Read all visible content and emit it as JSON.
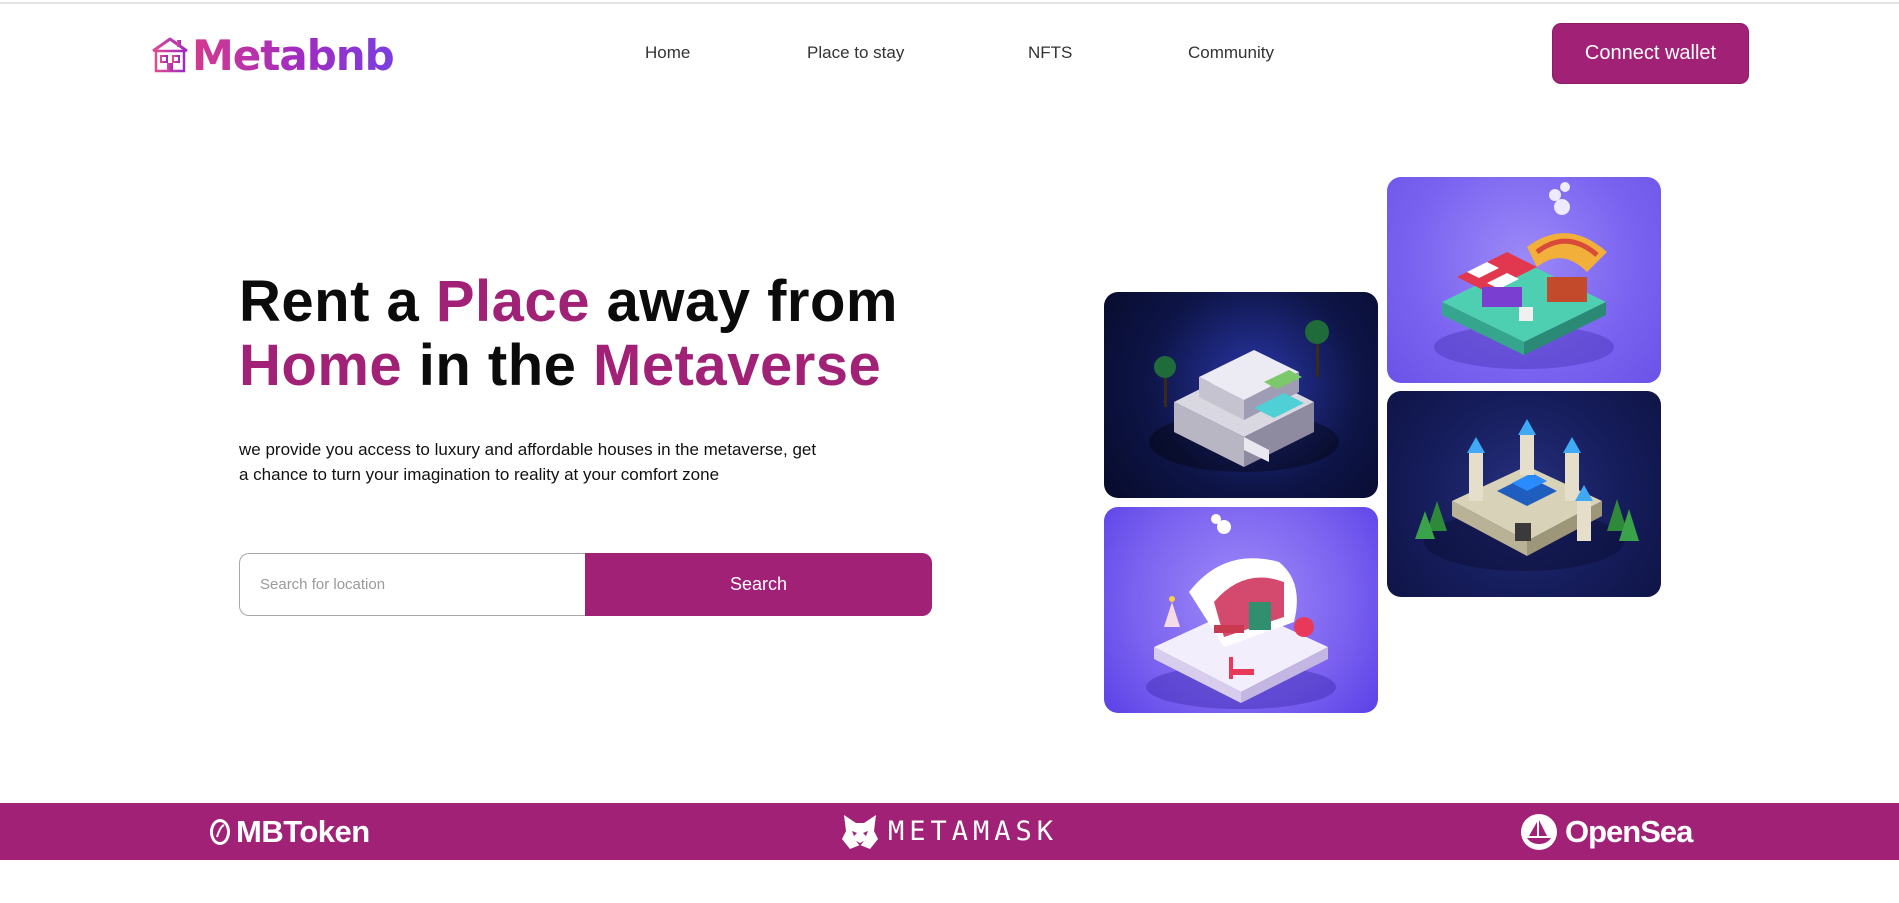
{
  "brand": {
    "name": "Metabnb",
    "icon": "house-icon",
    "gradient": [
      "#d43a8e",
      "#7b3fe0"
    ]
  },
  "nav": {
    "items": [
      {
        "label": "Home"
      },
      {
        "label": "Place to stay"
      },
      {
        "label": "NFTS"
      },
      {
        "label": "Community"
      }
    ],
    "connect_label": "Connect wallet"
  },
  "hero": {
    "title_parts": [
      "Rent a ",
      "Place",
      " away from",
      "Home",
      " in the ",
      "Metaverse"
    ],
    "description": "we provide you access to luxury and affordable houses in the metaverse, get a chance to turn your imagination to reality at your comfort zone",
    "search_placeholder": "Search for location",
    "search_label": "Search"
  },
  "gallery": [
    {
      "name": "villa",
      "icon": "modern-villa-image"
    },
    {
      "name": "market",
      "icon": "market-stall-image"
    },
    {
      "name": "castle",
      "icon": "castle-image"
    },
    {
      "name": "snow-house",
      "icon": "snow-house-image"
    }
  ],
  "partners": [
    {
      "label": "MBToken",
      "icon": "mbtoken-icon"
    },
    {
      "label": "METAMASK",
      "icon": "fox-icon"
    },
    {
      "label": "OpenSea",
      "icon": "sailboat-icon"
    }
  ],
  "colors": {
    "accent": "#a02176",
    "text": "#0b0b0b",
    "background": "#ffffff"
  }
}
